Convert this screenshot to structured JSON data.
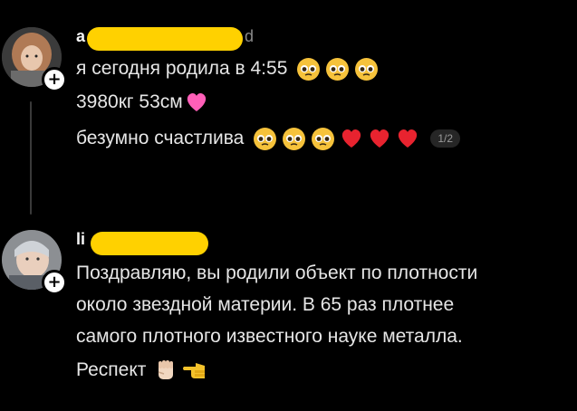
{
  "post1": {
    "username_visible_start": "a",
    "username_visible_end": "d",
    "lines": [
      "я сегодня родила в 4:55",
      "3980кг 53см",
      "безумно счастлива"
    ],
    "page_indicator": "1/2",
    "line1_emojis": [
      "pleading-face-emoji",
      "pleading-face-emoji",
      "pleading-face-emoji"
    ],
    "line2_emojis": [
      "pink-heart-emoji"
    ],
    "line3_emojis": [
      "pleading-face-emoji",
      "pleading-face-emoji",
      "pleading-face-emoji",
      "red-heart-emoji",
      "red-heart-emoji",
      "red-heart-emoji"
    ]
  },
  "post2": {
    "username_visible_start": "li",
    "lines": [
      "Поздравляю, вы родили объект по плотности",
      "около звездной материи. В 65 раз плотнее",
      "самого плотного известного науке металла.",
      "Респект"
    ],
    "line4_emojis": [
      "raised-fist-emoji",
      "backhand-index-pointing-left-emoji"
    ]
  },
  "colors": {
    "background": "#000000",
    "text": "#e6e6e6",
    "redaction": "#ffd100",
    "thread_line": "#3a3a3a",
    "badge_bg": "#262626"
  }
}
